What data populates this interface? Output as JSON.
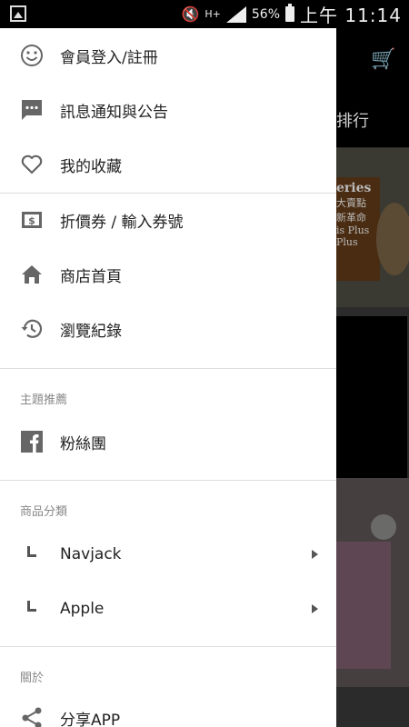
{
  "status_bar": {
    "network": "H+",
    "battery": "56%",
    "time": "上午 11:14"
  },
  "background_app": {
    "header_partial": "排行",
    "banner_partial_lines": [
      "eries",
      "大賣點",
      "新革命",
      "is Plus",
      "Plus"
    ]
  },
  "drawer": {
    "account": [
      {
        "icon": "smiley-icon",
        "label": "會員登入/註冊"
      },
      {
        "icon": "chat-message-icon",
        "label": "訊息通知與公告"
      },
      {
        "icon": "heart-icon",
        "label": "我的收藏"
      }
    ],
    "shop": [
      {
        "icon": "coupon-icon",
        "label": "折價券 / 輸入券號"
      },
      {
        "icon": "home-icon",
        "label": "商店首頁"
      },
      {
        "icon": "history-icon",
        "label": "瀏覽紀錄"
      }
    ],
    "topic_title": "主題推薦",
    "topics": [
      {
        "icon": "facebook-icon",
        "label": "粉絲團"
      }
    ],
    "category_title": "商品分類",
    "categories": [
      {
        "label": "Navjack"
      },
      {
        "label": "Apple"
      }
    ],
    "about_title": "關於",
    "about": [
      {
        "icon": "share-icon",
        "label": "分享APP"
      }
    ]
  },
  "colors": {
    "icon_gray": "#666666",
    "overlay": "#000000"
  }
}
